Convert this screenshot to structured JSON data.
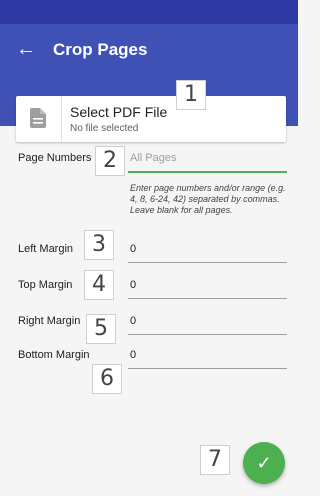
{
  "app": {
    "title": "Crop Pages"
  },
  "file": {
    "title": "Select PDF File",
    "subtitle": "No file selected"
  },
  "markers": [
    "1",
    "2",
    "3",
    "4",
    "5",
    "6",
    "7"
  ],
  "fields": {
    "page_numbers": {
      "label": "Page Numbers",
      "placeholder": "All Pages",
      "hint": "Enter page numbers and/or range (e.g. 4, 8, 6-24, 42) separated by commas. Leave blank for all pages."
    },
    "left_margin": {
      "label": "Left Margin",
      "value": "0"
    },
    "top_margin": {
      "label": "Top Margin",
      "value": "0"
    },
    "right_margin": {
      "label": "Right Margin",
      "value": "0"
    },
    "bottom_margin": {
      "label": "Bottom Margin",
      "value": "0"
    }
  },
  "colors": {
    "primary": "#3f51b5",
    "status_bar": "#2f3aa5",
    "accent": "#4caf50"
  },
  "icons": {
    "back": "arrow-left-icon",
    "file": "document-icon",
    "confirm": "check-icon"
  }
}
